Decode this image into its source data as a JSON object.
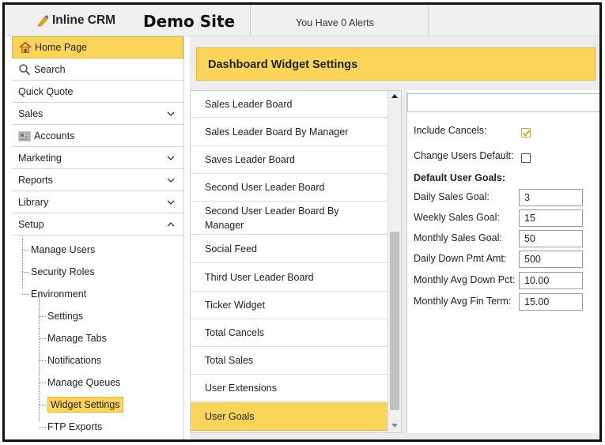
{
  "topbar": {
    "app_name": "Inline CRM",
    "site_name": "Demo Site",
    "alerts": "You Have 0 Alerts"
  },
  "sidebar": {
    "items": [
      {
        "label": "Home Page",
        "icon": "home-icon"
      },
      {
        "label": "Search",
        "icon": "search-icon"
      },
      {
        "label": "Quick Quote"
      },
      {
        "label": "Sales",
        "icon": "chevron-down-icon"
      },
      {
        "label": "Accounts",
        "icon": "accounts-icon"
      },
      {
        "label": "Marketing",
        "icon": "chevron-down-icon"
      },
      {
        "label": "Reports",
        "icon": "chevron-down-icon"
      },
      {
        "label": "Library",
        "icon": "chevron-down-icon"
      },
      {
        "label": "Setup",
        "icon": "chevron-up-icon"
      }
    ],
    "tree": {
      "manage_users": "Manage Users",
      "security_roles": "Security Roles",
      "environment": "Environment",
      "settings": "Settings",
      "manage_tabs": "Manage Tabs",
      "notifications": "Notifications",
      "manage_queues": "Manage Queues",
      "widget_settings": "Widget Settings",
      "ftp_exports": "FTP Exports"
    }
  },
  "main": {
    "title": "Dashboard Widget Settings",
    "widgets": [
      "Sales Leader Board",
      "Sales Leader Board By Manager",
      "Saves Leader Board",
      "Second User Leader Board",
      "Second User Leader Board By Manager",
      "Social Feed",
      "Third User Leader Board",
      "Ticker Widget",
      "Total Cancels",
      "Total Sales",
      "User Extensions",
      "User Goals"
    ],
    "selected_widget": "User Goals"
  },
  "settings": {
    "include_cancels_label": "Include Cancels:",
    "include_cancels_checked": true,
    "change_users_default_label": "Change Users Default:",
    "change_users_default_checked": false,
    "default_goals_heading": "Default User Goals:",
    "daily_sales_goal_label": "Daily Sales Goal:",
    "daily_sales_goal_value": "3",
    "weekly_sales_goal_label": "Weekly Sales Goal:",
    "weekly_sales_goal_value": "15",
    "monthly_sales_goal_label": "Monthly Sales Goal:",
    "monthly_sales_goal_value": "50",
    "daily_down_pmt_label": "Daily Down Pmt Amt:",
    "daily_down_pmt_value": "500",
    "monthly_avg_down_pct_label": "Monthly Avg Down Pct:",
    "monthly_avg_down_pct_value": "10.00",
    "monthly_avg_fin_term_label": "Monthly Avg Fin Term:",
    "monthly_avg_fin_term_value": "15.00"
  },
  "colors": {
    "accent": "#fbd45a",
    "accent_border": "#e3b32e",
    "checkbox_check": "#d9a441"
  }
}
